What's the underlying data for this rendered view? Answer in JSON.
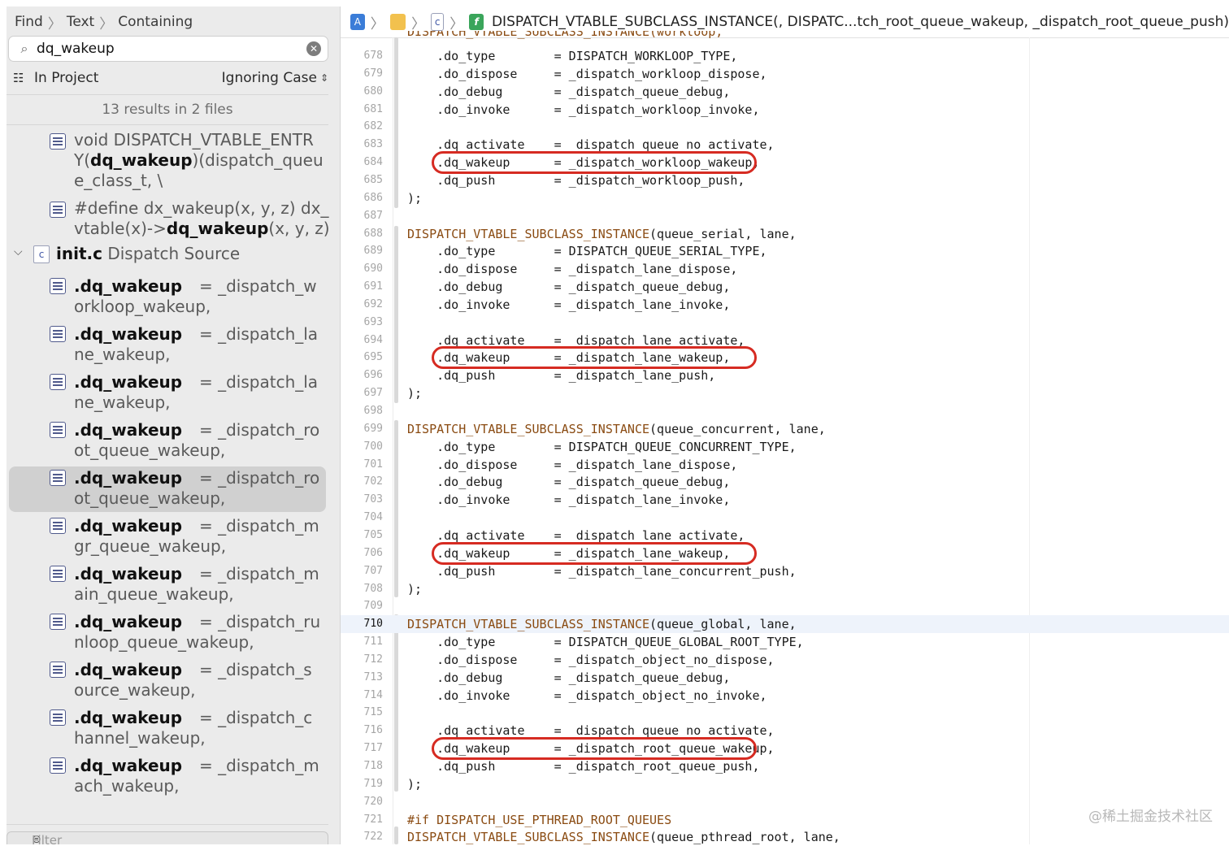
{
  "find": {
    "breadcrumb": [
      "Find",
      "Text",
      "Containing"
    ],
    "search_value": "dq_wakeup",
    "scope": "In Project",
    "case_mode": "Ignoring Case",
    "results_summary": "13 results in 2 files",
    "filter_placeholder": "Filter"
  },
  "results": {
    "top": [
      {
        "l1a": "void DISPATCH_VTABLE_ENTR",
        "l2a": "Y(",
        "m": "dq_wakeup",
        "l2b": ")(dispatch_queu",
        "l3": "e_class_t, \\"
      },
      {
        "l1a": "#define dx_wakeup(x, y, z) dx_",
        "l2a": "vtable(x)->",
        "m": "dq_wakeup",
        "l2b": "(x, y, z)"
      }
    ],
    "file_group": {
      "name": "init.c",
      "path": "Dispatch Source",
      "type_icon": "c"
    },
    "file_items": [
      {
        "m": ".dq_wakeup",
        "a": "= _dispatch_w",
        "b": "orkloop_wakeup,"
      },
      {
        "m": ".dq_wakeup",
        "a": "= _dispatch_la",
        "b": "ne_wakeup,"
      },
      {
        "m": ".dq_wakeup",
        "a": "= _dispatch_la",
        "b": "ne_wakeup,"
      },
      {
        "m": ".dq_wakeup",
        "a": "= _dispatch_ro",
        "b": "ot_queue_wakeup,"
      },
      {
        "m": ".dq_wakeup",
        "a": "= _dispatch_ro",
        "b": "ot_queue_wakeup,",
        "selected": true
      },
      {
        "m": ".dq_wakeup",
        "a": "= _dispatch_m",
        "b": "gr_queue_wakeup,"
      },
      {
        "m": ".dq_wakeup",
        "a": "= _dispatch_m",
        "b": "ain_queue_wakeup,"
      },
      {
        "m": ".dq_wakeup",
        "a": "= _dispatch_ru",
        "b": "nloop_queue_wakeup,"
      },
      {
        "m": ".dq_wakeup",
        "a": "= _dispatch_s",
        "b": "ource_wakeup,"
      },
      {
        "m": ".dq_wakeup",
        "a": "= _dispatch_c",
        "b": "hannel_wakeup,"
      },
      {
        "m": ".dq_wakeup",
        "a": "= _dispatch_m",
        "b": "ach_wakeup,"
      }
    ]
  },
  "editor": {
    "jumpbar_file": "c",
    "jumpbar_title": "DISPATCH_VTABLE_SUBCLASS_INSTANCE(, DISPATC...tch_root_queue_wakeup, _dispatch_root_queue_push)",
    "partial_top_line": "DISPATCH_VTABLE_SUBCLASS_INSTANCE(workloop,",
    "current_line": "710",
    "lines": [
      {
        "n": "678",
        "t": "    .do_type        = DISPATCH_WORKLOOP_TYPE,"
      },
      {
        "n": "679",
        "t": "    .do_dispose     = _dispatch_workloop_dispose,"
      },
      {
        "n": "680",
        "t": "    .do_debug       = _dispatch_queue_debug,"
      },
      {
        "n": "681",
        "t": "    .do_invoke      = _dispatch_workloop_invoke,"
      },
      {
        "n": "682",
        "t": ""
      },
      {
        "n": "683",
        "t": "    .dq_activate    = _dispatch_queue_no_activate,"
      },
      {
        "n": "684",
        "t": "    .dq_wakeup      = _dispatch_workloop_wakeup,"
      },
      {
        "n": "685",
        "t": "    .dq_push        = _dispatch_workloop_push,"
      },
      {
        "n": "686",
        "t": ");"
      },
      {
        "n": "687",
        "t": ""
      },
      {
        "n": "688",
        "mac": "DISPATCH_VTABLE_SUBCLASS_INSTANCE",
        "t": "(queue_serial, lane,"
      },
      {
        "n": "689",
        "t": "    .do_type        = DISPATCH_QUEUE_SERIAL_TYPE,"
      },
      {
        "n": "690",
        "t": "    .do_dispose     = _dispatch_lane_dispose,"
      },
      {
        "n": "691",
        "t": "    .do_debug       = _dispatch_queue_debug,"
      },
      {
        "n": "692",
        "t": "    .do_invoke      = _dispatch_lane_invoke,"
      },
      {
        "n": "693",
        "t": ""
      },
      {
        "n": "694",
        "t": "    .dq_activate    = _dispatch_lane_activate,"
      },
      {
        "n": "695",
        "t": "    .dq_wakeup      = _dispatch_lane_wakeup,"
      },
      {
        "n": "696",
        "t": "    .dq_push        = _dispatch_lane_push,"
      },
      {
        "n": "697",
        "t": ");"
      },
      {
        "n": "698",
        "t": ""
      },
      {
        "n": "699",
        "mac": "DISPATCH_VTABLE_SUBCLASS_INSTANCE",
        "t": "(queue_concurrent, lane,"
      },
      {
        "n": "700",
        "t": "    .do_type        = DISPATCH_QUEUE_CONCURRENT_TYPE,"
      },
      {
        "n": "701",
        "t": "    .do_dispose     = _dispatch_lane_dispose,"
      },
      {
        "n": "702",
        "t": "    .do_debug       = _dispatch_queue_debug,"
      },
      {
        "n": "703",
        "t": "    .do_invoke      = _dispatch_lane_invoke,"
      },
      {
        "n": "704",
        "t": ""
      },
      {
        "n": "705",
        "t": "    .dq_activate    = _dispatch_lane_activate,"
      },
      {
        "n": "706",
        "t": "    .dq_wakeup      = _dispatch_lane_wakeup,"
      },
      {
        "n": "707",
        "t": "    .dq_push        = _dispatch_lane_concurrent_push,"
      },
      {
        "n": "708",
        "t": ");"
      },
      {
        "n": "709",
        "t": ""
      },
      {
        "n": "710",
        "mac": "DISPATCH_VTABLE_SUBCLASS_INSTANCE",
        "t": "(queue_global, lane,"
      },
      {
        "n": "711",
        "t": "    .do_type        = DISPATCH_QUEUE_GLOBAL_ROOT_TYPE,"
      },
      {
        "n": "712",
        "t": "    .do_dispose     = _dispatch_object_no_dispose,"
      },
      {
        "n": "713",
        "t": "    .do_debug       = _dispatch_queue_debug,"
      },
      {
        "n": "714",
        "t": "    .do_invoke      = _dispatch_object_no_invoke,"
      },
      {
        "n": "715",
        "t": ""
      },
      {
        "n": "716",
        "t": "    .dq_activate    = _dispatch_queue_no_activate,"
      },
      {
        "n": "717",
        "t": "    .dq_wakeup      = _dispatch_root_queue_wakeup,"
      },
      {
        "n": "718",
        "t": "    .dq_push        = _dispatch_root_queue_push,"
      },
      {
        "n": "719",
        "t": ");"
      },
      {
        "n": "720",
        "t": ""
      },
      {
        "n": "721",
        "mac": "#if DISPATCH_USE_PTHREAD_ROOT_QUEUES",
        "t": ""
      },
      {
        "n": "722",
        "mac": "DISPATCH_VTABLE_SUBCLASS_INSTANCE",
        "t": "(queue_pthread_root, lane,"
      }
    ],
    "highlighted_lines": [
      "684",
      "695",
      "706",
      "717"
    ]
  },
  "watermark": "@稀土掘金技术社区",
  "colors": {
    "highlight_ring": "#d62b22",
    "macro": "#8a4b12",
    "selected_row": "#d0d0d0"
  }
}
